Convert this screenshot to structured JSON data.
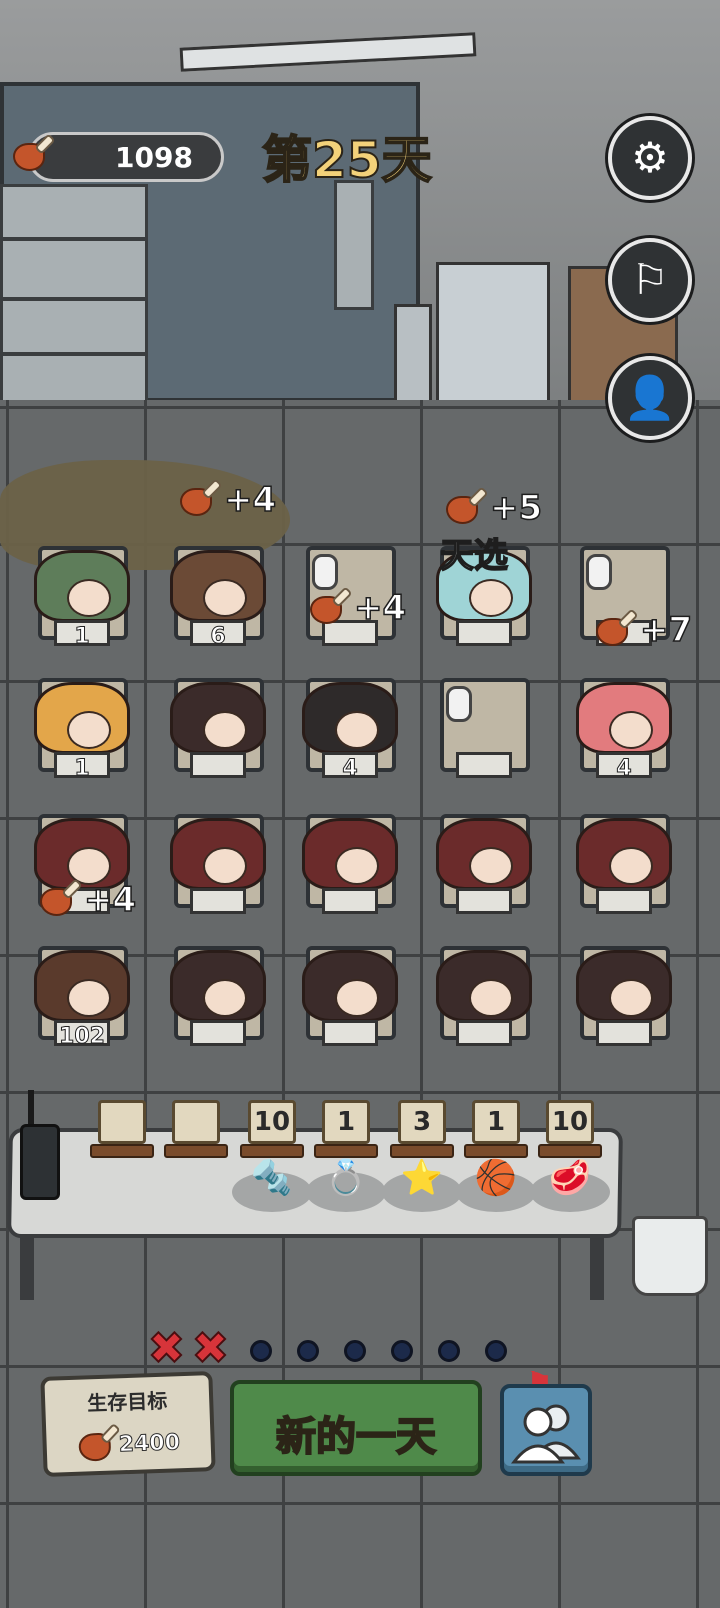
{
  "hud": {
    "meat_total": "1098",
    "day_title": "第25天",
    "settings_icon": "gear-icon",
    "flag_icon": "white-flag-icon",
    "search_person_icon": "person-search-icon"
  },
  "beds": [
    {
      "row": 1,
      "col": 1,
      "count": "1",
      "occupant": "robot-survivor"
    },
    {
      "row": 1,
      "col": 2,
      "count": "6",
      "occupant": "bearded-man"
    },
    {
      "row": 1,
      "col": 3,
      "count": "",
      "occupant": "empty"
    },
    {
      "row": 1,
      "col": 4,
      "count": "",
      "occupant": "cat-creature"
    },
    {
      "row": 1,
      "col": 5,
      "count": "",
      "occupant": "empty"
    },
    {
      "row": 2,
      "col": 1,
      "count": "1",
      "occupant": "blonde-girl"
    },
    {
      "row": 2,
      "col": 2,
      "count": "",
      "occupant": "ponytail-girl"
    },
    {
      "row": 2,
      "col": 3,
      "count": "4",
      "occupant": "black-hair-boy"
    },
    {
      "row": 2,
      "col": 4,
      "count": "",
      "occupant": "empty"
    },
    {
      "row": 2,
      "col": 5,
      "count": "4",
      "occupant": "pink-hair-girl"
    },
    {
      "row": 3,
      "col": 1,
      "count": "",
      "occupant": "hooded-girl"
    },
    {
      "row": 3,
      "col": 2,
      "count": "",
      "occupant": "hooded-girl"
    },
    {
      "row": 3,
      "col": 3,
      "count": "",
      "occupant": "hooded-girl"
    },
    {
      "row": 3,
      "col": 4,
      "count": "",
      "occupant": "hooded-girl"
    },
    {
      "row": 3,
      "col": 5,
      "count": "",
      "occupant": "hooded-girl"
    },
    {
      "row": 4,
      "col": 1,
      "count": "102",
      "occupant": "injured-girl"
    },
    {
      "row": 4,
      "col": 2,
      "count": "",
      "occupant": "ponytail-girl"
    },
    {
      "row": 4,
      "col": 3,
      "count": "",
      "occupant": "ponytail-girl"
    },
    {
      "row": 4,
      "col": 4,
      "count": "",
      "occupant": "ponytail-girl"
    },
    {
      "row": 4,
      "col": 5,
      "count": "",
      "occupant": "ponytail-girl"
    }
  ],
  "bonuses": {
    "b1": "+4",
    "b2": "+5",
    "b3": "+4",
    "b4": "+7",
    "b5": "+4"
  },
  "chosen_label": "天选",
  "items": [
    {
      "count": "",
      "icon": "empty-slot"
    },
    {
      "count": "",
      "icon": "empty-slot"
    },
    {
      "count": "10",
      "icon": "bolt-icon"
    },
    {
      "count": "1",
      "icon": "ring-box-icon"
    },
    {
      "count": "3",
      "icon": "star-icon"
    },
    {
      "count": "1",
      "icon": "basketball-icon"
    },
    {
      "count": "10",
      "icon": "raw-meat-icon"
    }
  ],
  "progress": {
    "completed_marks": 2,
    "remaining_dots": 6,
    "goal_icon": "red-flag-icon"
  },
  "goal": {
    "title": "生存目标",
    "value": "2400"
  },
  "buttons": {
    "new_day": "新的一天",
    "people_icon": "people-icon"
  },
  "colors": {
    "title_gold": "#f3d27a",
    "button_green": "#4f8a4a",
    "button_blue": "#5a8fb0",
    "mark_red": "#d7343a"
  }
}
